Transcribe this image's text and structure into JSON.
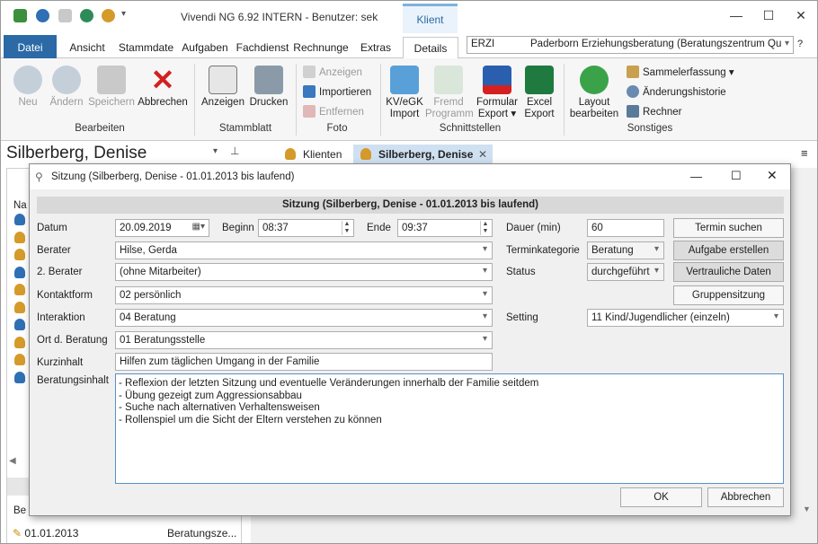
{
  "app": {
    "title": "Vivendi NG 6.92 INTERN - Benutzer: sek",
    "context_tab": "Klient"
  },
  "tabs": [
    "Datei",
    "Ansicht",
    "Stammdate",
    "Aufgaben",
    "Fachdienst",
    "Rechnunge",
    "Extras",
    "Details"
  ],
  "org_selector": {
    "code": "ERZI",
    "name": "Paderborn Erziehungsberatung (Beratungszentrum Qu"
  },
  "help": "?",
  "ribbon": {
    "bearbeiten": {
      "label": "Bearbeiten",
      "neu": "Neu",
      "aendern": "Ändern",
      "speichern": "Speichern",
      "abbrechen": "Abbrechen"
    },
    "stammblatt": {
      "label": "Stammblatt",
      "anzeigen": "Anzeigen",
      "drucken": "Drucken"
    },
    "foto": {
      "label": "Foto",
      "anzeigen": "Anzeigen",
      "importieren": "Importieren",
      "entfernen": "Entfernen"
    },
    "schnittstellen": {
      "label": "Schnittstellen",
      "kvegk_1": "KV/eGK",
      "kvegk_2": "Import",
      "fremd_1": "Fremd",
      "fremd_2": "Programm",
      "formular_1": "Formular",
      "formular_2": "Export",
      "excel_1": "Excel",
      "excel_2": "Export"
    },
    "sonstiges": {
      "label": "Sonstiges",
      "layout_1": "Layout",
      "layout_2": "bearbeiten",
      "sammelerfassung": "Sammelerfassung",
      "aenderungshistorie": "Änderungshistorie",
      "rechner": "Rechner"
    }
  },
  "client": {
    "name": "Silberberg, Denise"
  },
  "doc_tabs": {
    "klienten": "Klienten",
    "current": "Silberberg, Denise"
  },
  "left_panel": {
    "col": "Na",
    "bottom_label": "Be",
    "row_date": "01.01.2013",
    "row_text": "Beratungsze..."
  },
  "dialog": {
    "title": "Sitzung (Silberberg, Denise - 01.01.2013 bis laufend)",
    "header": "Sitzung (Silberberg, Denise - 01.01.2013 bis laufend)",
    "labels": {
      "datum": "Datum",
      "beginn": "Beginn",
      "ende": "Ende",
      "berater": "Berater",
      "berater2": "2. Berater",
      "kontaktform": "Kontaktform",
      "interaktion": "Interaktion",
      "ort": "Ort d. Beratung",
      "kurzinhalt": "Kurzinhalt",
      "beratungsinhalt": "Beratungsinhalt",
      "dauer": "Dauer (min)",
      "terminkategorie": "Terminkategorie",
      "status": "Status",
      "setting": "Setting"
    },
    "values": {
      "datum": "20.09.2019",
      "beginn": "08:37",
      "ende": "09:37",
      "berater": "Hilse, Gerda",
      "berater2": "(ohne Mitarbeiter)",
      "kontaktform": "02  persönlich",
      "interaktion": "04  Beratung",
      "ort": "01  Beratungsstelle",
      "kurzinhalt": "Hilfen zum täglichen Umgang in der Familie",
      "dauer": "60",
      "terminkategorie": "Beratung",
      "status": "durchgeführt",
      "setting": "11  Kind/Jugendlicher (einzeln)"
    },
    "beratungsinhalt": [
      "- Reflexion der letzten Sitzung und eventuelle Veränderungen innerhalb der Familie seitdem",
      "- Übung gezeigt zum Aggressionsabbau",
      "- Suche nach alternativen Verhaltensweisen",
      "- Rollenspiel um die Sicht der Eltern verstehen zu können"
    ],
    "buttons": {
      "termin": "Termin suchen",
      "aufgabe": "Aufgabe erstellen",
      "vertraulich": "Vertrauliche Daten",
      "gruppen": "Gruppensitzung",
      "ok": "OK",
      "abbrechen": "Abbrechen"
    }
  }
}
